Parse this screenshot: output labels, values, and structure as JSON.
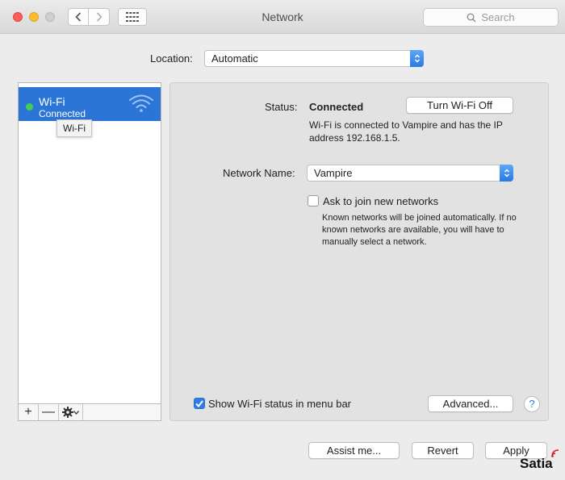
{
  "window": {
    "title": "Network"
  },
  "search": {
    "placeholder": "Search"
  },
  "location": {
    "label": "Location:",
    "value": "Automatic"
  },
  "sidebar": {
    "services": [
      {
        "name": "Wi-Fi",
        "status": "Connected",
        "status_color": "#3dd14c"
      }
    ],
    "tooltip": "Wi-Fi",
    "toolbar": {
      "add_label": "+",
      "remove_label": "—"
    }
  },
  "detail": {
    "status_label": "Status:",
    "status_value": "Connected",
    "turn_off_label": "Turn Wi-Fi Off",
    "status_description": "Wi-Fi is connected to Vampire and has the IP address 192.168.1.5.",
    "network_name_label": "Network Name:",
    "network_name_value": "Vampire",
    "ask_join_label": "Ask to join new networks",
    "ask_join_checked": false,
    "ask_join_description": "Known networks will be joined automatically. If no known networks are available, you will have to manually select a network.",
    "show_status_label": "Show Wi-Fi status in menu bar",
    "show_status_checked": true,
    "advanced_label": "Advanced...",
    "help_label": "?"
  },
  "footer": {
    "assist_label": "Assist me...",
    "revert_label": "Revert",
    "apply_label": "Apply"
  },
  "watermark": "Satia",
  "colors": {
    "accent": "#2a75d6",
    "connected": "#3dd14c"
  }
}
